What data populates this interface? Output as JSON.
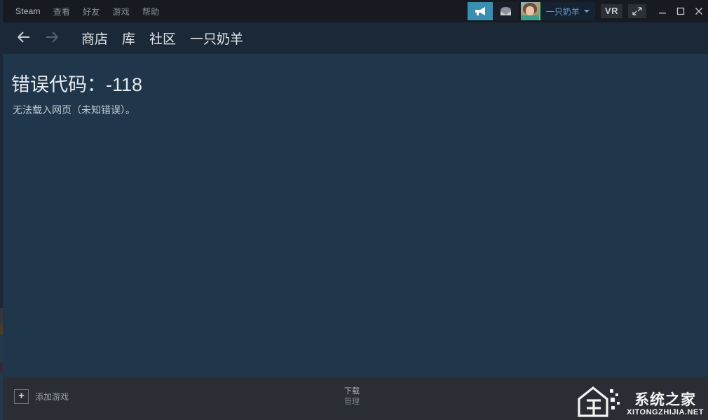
{
  "window": {
    "app_name": "Steam",
    "menu": [
      {
        "label": "Steam",
        "name": "menu-steam"
      },
      {
        "label": "查看",
        "name": "menu-view"
      },
      {
        "label": "好友",
        "name": "menu-friends"
      },
      {
        "label": "游戏",
        "name": "menu-games"
      },
      {
        "label": "帮助",
        "name": "menu-help"
      }
    ],
    "controls": {
      "broadcast_icon": "megaphone-icon",
      "mail_icon": "envelope-icon",
      "vr_label": "VR",
      "expand_icon": "expand-icon",
      "minimize_label": "_",
      "maximize_label": "□",
      "close_label": "✕"
    },
    "user": {
      "name": "一只奶羊",
      "avatar_name": "user-avatar",
      "status_color": "#57cf5a",
      "dropdown_icon": "chevron-down-icon"
    }
  },
  "nav": {
    "back_icon": "arrow-left-icon",
    "forward_icon": "arrow-right-icon",
    "links": [
      {
        "label": "商店",
        "name": "nav-store"
      },
      {
        "label": "库",
        "name": "nav-library"
      },
      {
        "label": "社区",
        "name": "nav-community"
      },
      {
        "label": "一只奶羊",
        "name": "nav-profile"
      }
    ]
  },
  "content": {
    "error_title": "错误代码：-118",
    "error_message": "无法载入网页（未知错误）。",
    "background_color": "#1f364b"
  },
  "footer": {
    "add_game_icon": "plus-icon",
    "add_game_label": "添加游戏",
    "downloads_title": "下载",
    "downloads_sub": "管理"
  },
  "watermark": {
    "cn": "系统之家",
    "en": "XITONGZHIJIA.NET"
  }
}
